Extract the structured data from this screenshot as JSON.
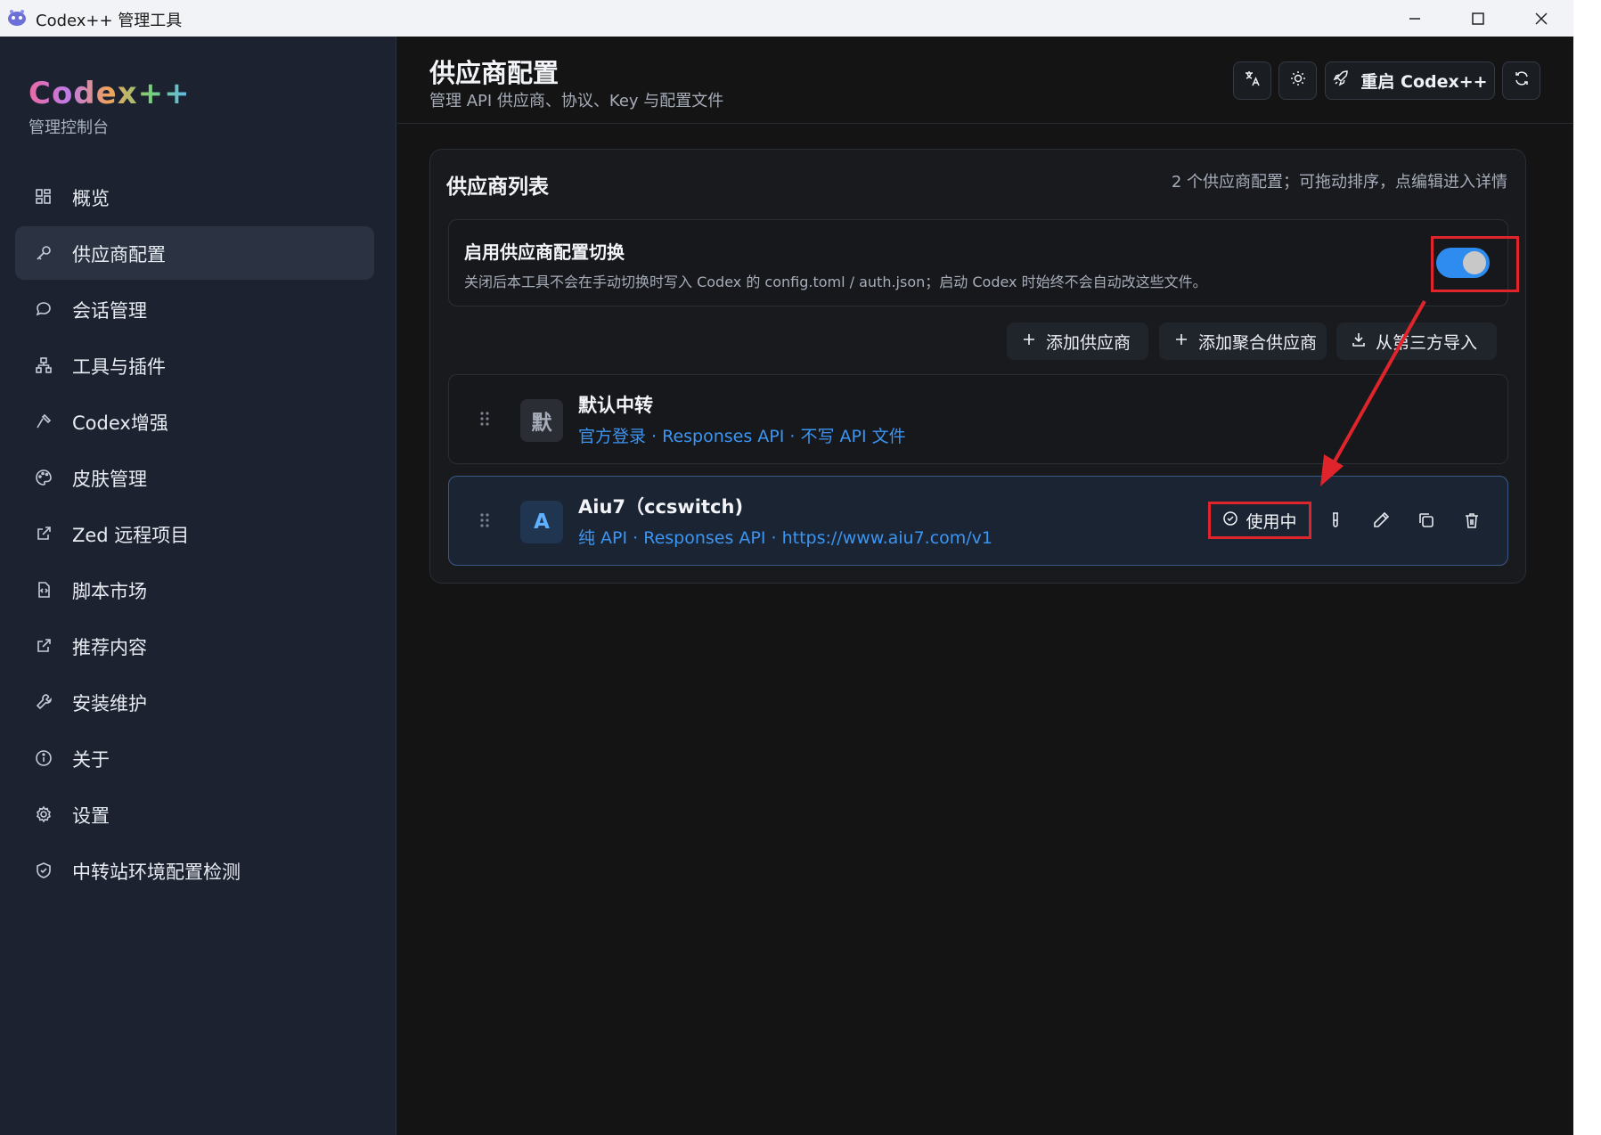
{
  "window": {
    "title": "Codex++ 管理工具",
    "controls": [
      "minimize-icon",
      "maximize-icon",
      "close-icon"
    ]
  },
  "sidebar": {
    "brand": "Codex++",
    "subtitle": "管理控制台",
    "items": [
      {
        "label": "概览",
        "icon": "dashboard-icon"
      },
      {
        "label": "供应商配置",
        "icon": "key-icon",
        "active": true
      },
      {
        "label": "会话管理",
        "icon": "chat-icon"
      },
      {
        "label": "工具与插件",
        "icon": "network-icon"
      },
      {
        "label": "Codex增强",
        "icon": "hammer-icon"
      },
      {
        "label": "皮肤管理",
        "icon": "palette-icon"
      },
      {
        "label": "Zed 远程项目",
        "icon": "external-link-icon"
      },
      {
        "label": "脚本市场",
        "icon": "script-icon"
      },
      {
        "label": "推荐内容",
        "icon": "external-link-icon"
      },
      {
        "label": "安装维护",
        "icon": "wrench-icon"
      },
      {
        "label": "关于",
        "icon": "info-icon"
      },
      {
        "label": "设置",
        "icon": "gear-icon"
      },
      {
        "label": "中转站环境配置检测",
        "icon": "shield-check-icon"
      }
    ]
  },
  "header": {
    "title": "供应商配置",
    "subtitle": "管理 API 供应商、协议、Key 与配置文件",
    "restart_label": "重启 Codex++"
  },
  "provider_list": {
    "title": "供应商列表",
    "hint": "2 个供应商配置；可拖动排序，点编辑进入详情",
    "toggle": {
      "title": "启用供应商配置切换",
      "description": "关闭后本工具不会在手动切换时写入 Codex 的 config.toml / auth.json；启动 Codex 时始终不会自动改这些文件。",
      "enabled": true
    },
    "actions": {
      "add": "添加供应商",
      "add_aggregate": "添加聚合供应商",
      "import": "从第三方导入"
    },
    "providers": [
      {
        "avatar": "默",
        "name": "默认中转",
        "meta": "官方登录 · Responses API · 不写 API 文件"
      },
      {
        "avatar": "A",
        "name": "Aiu7（ccswitch)",
        "meta": "纯 API · Responses API · https://www.aiu7.com/v1",
        "status": "使用中"
      }
    ]
  },
  "colors": {
    "accent": "#2e8bef",
    "link": "#3b95f2",
    "annotation": "#e0242b"
  }
}
